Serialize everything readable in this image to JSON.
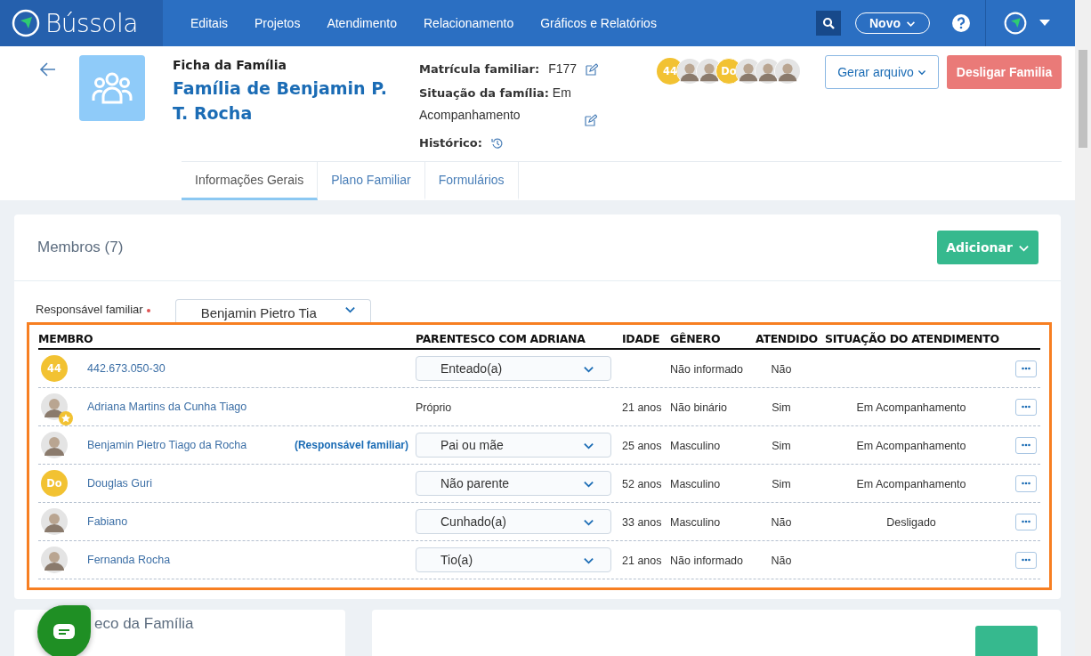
{
  "nav": {
    "brand": "Bússola",
    "items": [
      "Editais",
      "Projetos",
      "Atendimento",
      "Relacionamento",
      "Gráficos e Relatórios"
    ],
    "new_button": "Novo"
  },
  "header": {
    "subtitle": "Ficha da Família",
    "title": "Família de Benjamin P. T. Rocha",
    "registration": {
      "label": "Matrícula familiar:",
      "value": "F177"
    },
    "situation": {
      "label": "Situação da família:",
      "value": "Em Acompanhamento"
    },
    "history": {
      "label": "Histórico:"
    },
    "avatars": [
      {
        "kind": "initials",
        "text": "44"
      },
      {
        "kind": "photo"
      },
      {
        "kind": "photo"
      },
      {
        "kind": "initials",
        "text": "Do"
      },
      {
        "kind": "photo"
      },
      {
        "kind": "photo"
      },
      {
        "kind": "photo"
      }
    ],
    "buttons": {
      "export": "Gerar arquivo",
      "disconnect": "Desligar Familia"
    }
  },
  "tabs": [
    {
      "label": "Informações Gerais",
      "selected": true
    },
    {
      "label": "Plano Familiar",
      "selected": false
    },
    {
      "label": "Formulários",
      "selected": false
    }
  ],
  "members": {
    "title": "Membros (7)",
    "add_button": "Adicionar",
    "responsible_label": "Responsável familiar",
    "responsible_value": "Benjamin Pietro Tia",
    "columns": [
      "MEMBRO",
      "PARENTESCO COM ADRIANA",
      "IDADE",
      "GÊNERO",
      "ATENDIDO",
      "SITUAÇÃO DO ATENDIMENTO"
    ],
    "rows": [
      {
        "avatar": {
          "kind": "initials",
          "text": "44"
        },
        "starred": false,
        "name": "442.673.050-30",
        "relation": {
          "kind": "select",
          "value": "Enteado(a)"
        },
        "age": "",
        "gender": "Não informado",
        "attended": "Não",
        "status": ""
      },
      {
        "avatar": {
          "kind": "photo"
        },
        "starred": true,
        "name": "Adriana Martins da Cunha Tiago",
        "relation": {
          "kind": "text",
          "value": "Próprio"
        },
        "age": "21 anos",
        "gender": "Não binário",
        "attended": "Sim",
        "status": "Em Acompanhamento"
      },
      {
        "avatar": {
          "kind": "photo"
        },
        "starred": false,
        "name": "Benjamin Pietro Tiago da Rocha",
        "tag": "(Responsável familiar)",
        "relation": {
          "kind": "select",
          "value": "Pai ou mãe"
        },
        "age": "25 anos",
        "gender": "Masculino",
        "attended": "Sim",
        "status": "Em Acompanhamento"
      },
      {
        "avatar": {
          "kind": "initials",
          "text": "Do"
        },
        "starred": false,
        "name": "Douglas Guri",
        "relation": {
          "kind": "select",
          "value": "Não parente"
        },
        "age": "52 anos",
        "gender": "Masculino",
        "attended": "Sim",
        "status": "Em Acompanhamento"
      },
      {
        "avatar": {
          "kind": "photo"
        },
        "starred": false,
        "name": "Fabiano",
        "relation": {
          "kind": "select",
          "value": "Cunhado(a)"
        },
        "age": "33 anos",
        "gender": "Masculino",
        "attended": "Não",
        "status": "Desligado"
      },
      {
        "avatar": {
          "kind": "photo"
        },
        "starred": false,
        "name": "Fernanda Rocha",
        "relation": {
          "kind": "select",
          "value": "Tio(a)"
        },
        "age": "21 anos",
        "gender": "Não informado",
        "attended": "Não",
        "status": ""
      }
    ]
  },
  "address": {
    "title": "eco da Família"
  }
}
